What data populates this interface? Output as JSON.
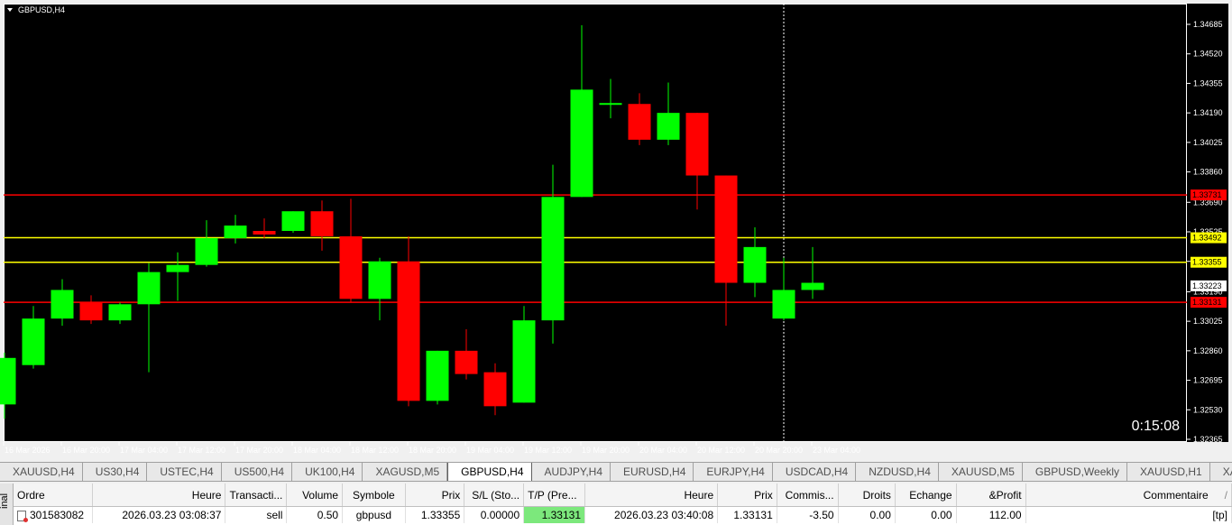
{
  "chart": {
    "title": "GBPUSD,H4",
    "timer": "0:15:08",
    "price_labels": [
      "1.34685",
      "1.34520",
      "1.34355",
      "1.34190",
      "1.34025",
      "1.33860",
      "1.33690",
      "1.33525",
      "1.33360",
      "1.33190",
      "1.33025",
      "1.32860",
      "1.32695",
      "1.32530",
      "1.32365"
    ],
    "time_labels": [
      "16 Mar 2026",
      "16 Mar 20:00",
      "17 Mar 04:00",
      "17 Mar 12:00",
      "17 Mar 20:00",
      "18 Mar 04:00",
      "18 Mar 12:00",
      "18 Mar 20:00",
      "19 Mar 04:00",
      "19 Mar 12:00",
      "19 Mar 20:00",
      "20 Mar 04:00",
      "20 Mar 12:00",
      "20 Mar 20:00",
      "23 Mar 04:00"
    ],
    "colors": {
      "background": "#000000",
      "bull": "#00ff00",
      "bear": "#ff0000",
      "text": "#ffffff",
      "red_line": "#ff0000",
      "yellow_line": "#ffff00"
    },
    "levels": [
      {
        "price": "1.33731",
        "color": "#ff0000",
        "label_bg": "#ff0000",
        "label_color": "#000000"
      },
      {
        "price": "1.33492",
        "color": "#ffff00",
        "label_bg": "#ffff00",
        "label_color": "#000000"
      },
      {
        "price": "1.33355",
        "color": "#ffff00",
        "label_bg": "#ffff00",
        "label_color": "#000000"
      },
      {
        "price": "1.33131",
        "color": "#ff0000",
        "label_bg": "#ff0000",
        "label_color": "#000000"
      }
    ],
    "current_price": "1.33223",
    "candles": [
      {
        "o": 1.3256,
        "h": 1.3285,
        "l": 1.3248,
        "c": 1.3282
      },
      {
        "o": 1.3278,
        "h": 1.3311,
        "l": 1.3276,
        "c": 1.3304
      },
      {
        "o": 1.3304,
        "h": 1.3326,
        "l": 1.33,
        "c": 1.332
      },
      {
        "o": 1.3313,
        "h": 1.3317,
        "l": 1.3301,
        "c": 1.3303
      },
      {
        "o": 1.3303,
        "h": 1.3313,
        "l": 1.3301,
        "c": 1.3312
      },
      {
        "o": 1.3312,
        "h": 1.3335,
        "l": 1.3274,
        "c": 1.333
      },
      {
        "o": 1.333,
        "h": 1.3341,
        "l": 1.3314,
        "c": 1.3334
      },
      {
        "o": 1.3334,
        "h": 1.3359,
        "l": 1.3333,
        "c": 1.3349
      },
      {
        "o": 1.3349,
        "h": 1.3362,
        "l": 1.3346,
        "c": 1.3356
      },
      {
        "o": 1.3353,
        "h": 1.336,
        "l": 1.3349,
        "c": 1.3351
      },
      {
        "o": 1.3353,
        "h": 1.3364,
        "l": 1.3352,
        "c": 1.3364
      },
      {
        "o": 1.3364,
        "h": 1.337,
        "l": 1.3342,
        "c": 1.335
      },
      {
        "o": 1.335,
        "h": 1.3371,
        "l": 1.3313,
        "c": 1.3315
      },
      {
        "o": 1.3315,
        "h": 1.3338,
        "l": 1.3303,
        "c": 1.3336
      },
      {
        "o": 1.3336,
        "h": 1.335,
        "l": 1.3255,
        "c": 1.3258
      },
      {
        "o": 1.3258,
        "h": 1.3286,
        "l": 1.3256,
        "c": 1.3286
      },
      {
        "o": 1.3286,
        "h": 1.3298,
        "l": 1.327,
        "c": 1.3273
      },
      {
        "o": 1.3274,
        "h": 1.3279,
        "l": 1.325,
        "c": 1.3255
      },
      {
        "o": 1.3257,
        "h": 1.3311,
        "l": 1.3257,
        "c": 1.3303
      },
      {
        "o": 1.3303,
        "h": 1.339,
        "l": 1.329,
        "c": 1.3372
      },
      {
        "o": 1.3372,
        "h": 1.3468,
        "l": 1.3372,
        "c": 1.3432
      },
      {
        "o": 1.3424,
        "h": 1.3438,
        "l": 1.3416,
        "c": 1.3424
      },
      {
        "o": 1.3424,
        "h": 1.343,
        "l": 1.3401,
        "c": 1.3404
      },
      {
        "o": 1.3404,
        "h": 1.3436,
        "l": 1.3401,
        "c": 1.3419
      },
      {
        "o": 1.3419,
        "h": 1.3419,
        "l": 1.3365,
        "c": 1.3384
      },
      {
        "o": 1.3384,
        "h": 1.3384,
        "l": 1.33,
        "c": 1.3324
      },
      {
        "o": 1.3324,
        "h": 1.3355,
        "l": 1.3316,
        "c": 1.3344
      },
      {
        "o": 1.3304,
        "h": 1.3338,
        "l": 1.3303,
        "c": 1.332
      },
      {
        "o": 1.332,
        "h": 1.3344,
        "l": 1.3315,
        "c": 1.3324
      }
    ]
  },
  "symbol_tabs": [
    {
      "label": "XAUUSD,H4",
      "active": false
    },
    {
      "label": "US30,H4",
      "active": false
    },
    {
      "label": "USTEC,H4",
      "active": false
    },
    {
      "label": "US500,H4",
      "active": false
    },
    {
      "label": "UK100,H4",
      "active": false
    },
    {
      "label": "XAGUSD,M5",
      "active": false
    },
    {
      "label": "GBPUSD,H4",
      "active": true
    },
    {
      "label": "AUDJPY,H4",
      "active": false
    },
    {
      "label": "EURUSD,H4",
      "active": false
    },
    {
      "label": "EURJPY,H4",
      "active": false
    },
    {
      "label": "USDCAD,H4",
      "active": false
    },
    {
      "label": "NZDUSD,H4",
      "active": false
    },
    {
      "label": "XAUUSD,M5",
      "active": false
    },
    {
      "label": "GBPUSD,Weekly",
      "active": false
    },
    {
      "label": "XAUUSD,H1",
      "active": false
    },
    {
      "label": "XAUUSD,We",
      "active": false
    }
  ],
  "terminal": {
    "side_label": "inal",
    "columns": [
      "Ordre",
      "Heure",
      "Transacti...",
      "Volume",
      "Symbole",
      "Prix",
      "S/L (Sto...",
      "T/P (Pre...",
      "Heure",
      "Prix",
      "Commis...",
      "Droits",
      "Echange",
      "&Profit",
      "Commentaire"
    ],
    "sort_marker": "/",
    "rows": [
      [
        "301583082",
        "2026.03.23 03:08:37",
        "sell",
        "0.50",
        "gbpusd",
        "1.33355",
        "0.00000",
        "1.33131",
        "2026.03.23 03:40:08",
        "1.33131",
        "-3.50",
        "0.00",
        "0.00",
        "112.00",
        "[tp]"
      ]
    ]
  }
}
